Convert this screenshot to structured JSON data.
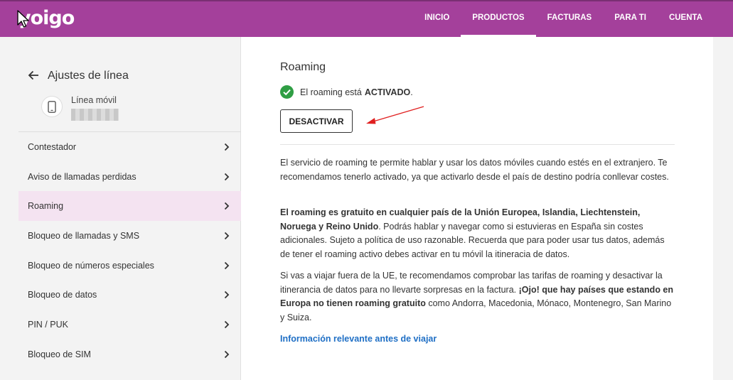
{
  "brand": {
    "logo": "yoigo",
    "accent": "#a4409b",
    "active_bg": "#f4e3f1",
    "link_color": "#1f6fc5"
  },
  "nav": {
    "items": [
      "INICIO",
      "PRODUCTOS",
      "FACTURAS",
      "PARA TI",
      "CUENTA"
    ],
    "active": "PRODUCTOS"
  },
  "sidebar": {
    "title": "Ajustes de línea",
    "line_label": "Línea móvil",
    "icons": {
      "back": "arrow-left-icon",
      "phone": "smartphone-icon",
      "chevron": "chevron-right-icon"
    },
    "items": [
      {
        "label": "Contestador"
      },
      {
        "label": "Aviso de llamadas perdidas"
      },
      {
        "label": "Roaming",
        "active": true
      },
      {
        "label": "Bloqueo de llamadas y SMS"
      },
      {
        "label": "Bloqueo de números especiales"
      },
      {
        "label": "Bloqueo de datos"
      },
      {
        "label": "PIN / PUK"
      },
      {
        "label": "Bloqueo de SIM"
      }
    ]
  },
  "main": {
    "title": "Roaming",
    "status_prefix": "El roaming está",
    "status_value": "ACTIVADO",
    "status_suffix": ".",
    "status_icon": "check-circle-icon",
    "button_label": "DESACTIVAR",
    "p1": "El servicio de roaming te permite hablar y usar los datos móviles cuando estés en el extranjero. Te recomendamos tenerlo activado, ya que activarlo desde el país de destino podría conllevar costes.",
    "p2_bold": "El roaming es gratuito en cualquier país de la Unión Europea, Islandia, Liechtenstein, Noruega y Reino Unido",
    "p2_rest": ". Podrás hablar y navegar como si estuvieras en España sin costes adicionales. Sujeto a política de uso razonable. Recuerda que para poder usar tus datos, además de tener el roaming activo debes activar en tu móvil la itineracia de datos.",
    "p3_a": "Si vas a viajar fuera de la UE, te recomendamos comprobar las tarifas de roaming y desactivar la itinerancia de datos para no llevarte sorpresas en la factura. ",
    "p3_bold": "¡Ojo! que hay países que estando en Europa no tienen roaming gratuito",
    "p3_b": " como Andorra, Macedonia, Mónaco, Montenegro, San Marino y Suiza.",
    "link": "Información relevante antes de viajar"
  }
}
